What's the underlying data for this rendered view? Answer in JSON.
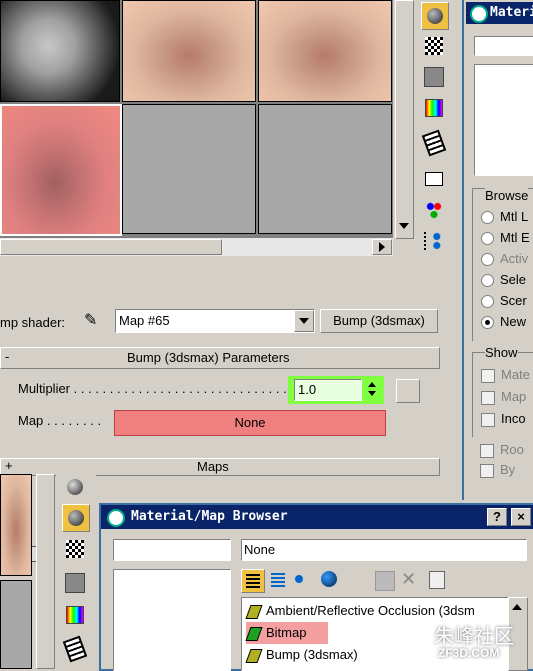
{
  "shader": {
    "label": "mp shader:",
    "map_name": "Map #65",
    "type_button": "Bump (3dsmax)"
  },
  "rollout_bump": {
    "toggle": "-",
    "title": "Bump (3dsmax) Parameters",
    "multiplier_label": "Multiplier . . . . . . . . . . . . . . . . . . . . . . . . . . . . . . . . . .",
    "multiplier_value": "1.0",
    "map_label": "Map . . . . . . . .",
    "map_value": "None"
  },
  "rollout_maps": {
    "toggle": "+",
    "title": "Maps"
  },
  "right_panel": {
    "title": "Materi",
    "browse_title": "Browse",
    "browse_options": [
      "Mtl L",
      "Mtl E",
      "Activ",
      "Sele",
      "Scer",
      "New"
    ],
    "browse_selected_index": 5,
    "show_title": "Show",
    "show_options": [
      "Mate",
      "Map",
      "Inco"
    ],
    "bottom_options": [
      "Roo",
      "By"
    ]
  },
  "browser": {
    "title": "Material/Map Browser",
    "help": "?",
    "close": "×",
    "name_value": "None",
    "items": [
      {
        "label": "Ambient/Reflective Occlusion (3dsm",
        "icon_color": "#b0b020"
      },
      {
        "label": "Bitmap",
        "icon_color": "#20a020"
      },
      {
        "label": "Bump (3dsmax)",
        "icon_color": "#b0b020"
      }
    ],
    "selected_index": 1
  },
  "watermark": {
    "brand": "朱峰社区",
    "url": "ZF3D.COM"
  },
  "colors": {
    "title_blue": "#0a246a",
    "map_button_red": "#f08080",
    "spinner_green": "#80ff40",
    "selected_item": "#f4a0a0"
  }
}
